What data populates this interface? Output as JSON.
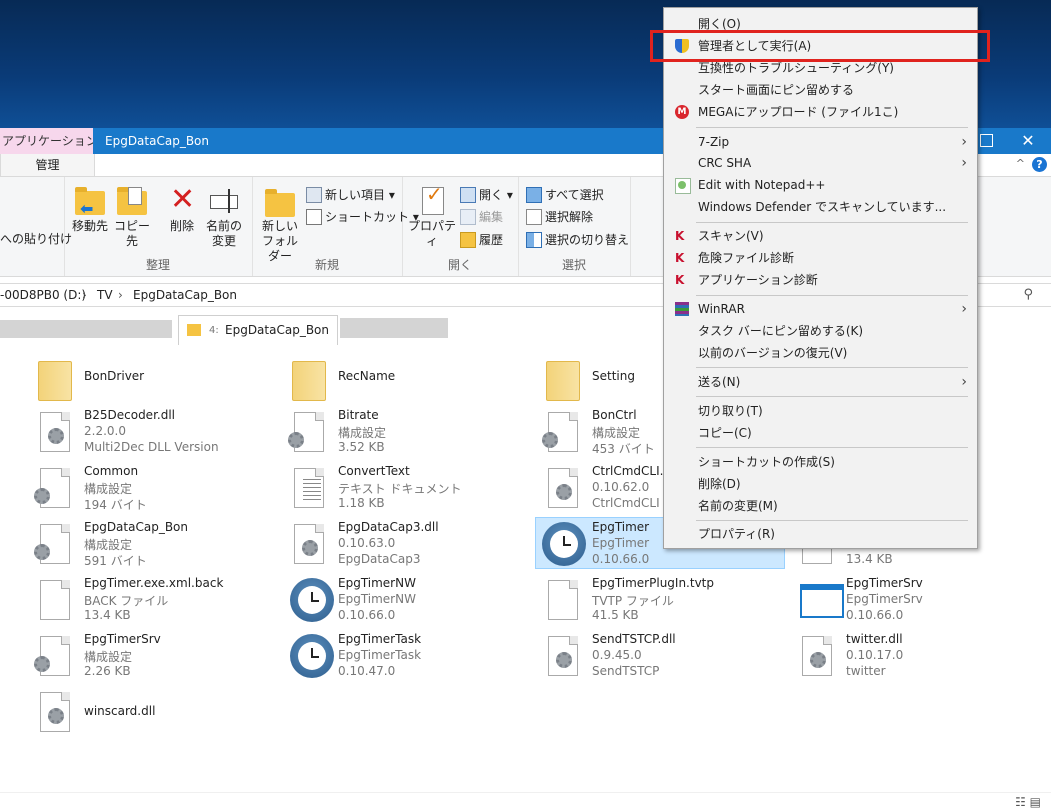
{
  "window": {
    "context_tab": "アプリケーション ツール",
    "title": "EpgDataCap_Bon",
    "close": "✕",
    "manage_tab": "管理",
    "help": "?",
    "caret": "^"
  },
  "ribbon": {
    "paste_shortcut": "への貼り付け",
    "move_to": "移動先",
    "copy_to": "コピー先",
    "delete": "削除",
    "rename_1": "名前の",
    "rename_2": "変更",
    "new_folder_1": "新しい",
    "new_folder_2": "フォルダー",
    "new_item": "新しい項目 ▾",
    "shortcut": "ショートカット ▾",
    "properties": "プロパティ",
    "open": "開く ▾",
    "edit": "編集",
    "history": "履歴",
    "select_all": "すべて選択",
    "select_none": "選択解除",
    "invert": "選択の切り替え",
    "group_organize": "整理",
    "group_new": "新規",
    "group_open": "開く",
    "group_select": "選択"
  },
  "address": {
    "drive": "-00D8PB0 (D:)",
    "sep1": "›",
    "tv": "TV",
    "sep2": "›",
    "folder": "EpgDataCap_Bon"
  },
  "tab_bar": {
    "prefix": "4:",
    "active_label": "EpgDataCap_Bon"
  },
  "files": [
    {
      "name": "BonDriver",
      "l2": "",
      "l3": "",
      "type": "folder"
    },
    {
      "name": "RecName",
      "l2": "",
      "l3": "",
      "type": "folder"
    },
    {
      "name": "Setting",
      "l2": "",
      "l3": "",
      "type": "folder"
    },
    {
      "name": "B25Decoder.dll",
      "l2": "2.2.0.0",
      "l3": "Multi2Dec DLL Version",
      "type": "dll"
    },
    {
      "name": "Bitrate",
      "l2": "構成設定",
      "l3": "3.52 KB",
      "type": "ini"
    },
    {
      "name": "BonCtrl",
      "l2": "構成設定",
      "l3": "453 バイト",
      "type": "ini"
    },
    {
      "name": "Common",
      "l2": "構成設定",
      "l3": "194 バイト",
      "type": "ini"
    },
    {
      "name": "ConvertText",
      "l2": "テキスト ドキュメント",
      "l3": "1.18 KB",
      "type": "txt"
    },
    {
      "name": "CtrlCmdCLI.dll",
      "l2": "0.10.62.0",
      "l3": "CtrlCmdCLI",
      "type": "dll"
    },
    {
      "name": "EpgDataCap_Bon",
      "l2": "構成設定",
      "l3": "591 バイト",
      "type": "ini"
    },
    {
      "name": "EpgDataCap3.dll",
      "l2": "0.10.63.0",
      "l3": "EpgDataCap3",
      "type": "dll"
    },
    {
      "name": "EpgTimer",
      "l2": "EpgTimer",
      "l3": "0.10.66.0",
      "type": "clock"
    },
    {
      "name": "",
      "l2": "",
      "l3": "13.4 KB",
      "type": "file"
    },
    {
      "name": "EpgTimer.exe.xml.back",
      "l2": "BACK ファイル",
      "l3": "13.4 KB",
      "type": "file"
    },
    {
      "name": "EpgTimerNW",
      "l2": "EpgTimerNW",
      "l3": "0.10.66.0",
      "type": "clock"
    },
    {
      "name": "EpgTimerPlugIn.tvtp",
      "l2": "TVTP ファイル",
      "l3": "41.5 KB",
      "type": "file"
    },
    {
      "name": "EpgTimerSrv",
      "l2": "EpgTimerSrv",
      "l3": "0.10.66.0",
      "type": "app"
    },
    {
      "name": "EpgTimerSrv",
      "l2": "構成設定",
      "l3": "2.26 KB",
      "type": "ini"
    },
    {
      "name": "EpgTimerTask",
      "l2": "EpgTimerTask",
      "l3": "0.10.47.0",
      "type": "clock"
    },
    {
      "name": "SendTSTCP.dll",
      "l2": "0.9.45.0",
      "l3": "SendTSTCP",
      "type": "dll"
    },
    {
      "name": "twitter.dll",
      "l2": "0.10.17.0",
      "l3": "twitter",
      "type": "dll"
    },
    {
      "name": "winscard.dll",
      "l2": "",
      "l3": "",
      "type": "dll"
    }
  ],
  "context_menu": {
    "open": "開く(O)",
    "run_as_admin": "管理者として実行(A)",
    "compat": "互換性のトラブルシューティング(Y)",
    "pin_start": "スタート画面にピン留めする",
    "mega": "MEGAにアップロード (ファイル1こ)",
    "zip": "7-Zip",
    "crc": "CRC SHA",
    "notepad": "Edit with Notepad++",
    "defender": "Windows Defender でスキャンしています...",
    "scan": "スキャン(V)",
    "danger": "危険ファイル診断",
    "app_diag": "アプリケーション診断",
    "winrar": "WinRAR",
    "pin_taskbar": "タスク バーにピン留めする(K)",
    "restore": "以前のバージョンの復元(V)",
    "send_to": "送る(N)",
    "cut": "切り取り(T)",
    "copy": "コピー(C)",
    "create_shortcut": "ショートカットの作成(S)",
    "delete": "削除(D)",
    "rename": "名前の変更(M)",
    "properties": "プロパティ(R)",
    "arrow": "›"
  },
  "status": {
    "views": "☷ ▤"
  },
  "colors": {
    "titlebar": "#1979ca",
    "highlight": "#e0231e",
    "selection": "#cce8ff"
  }
}
